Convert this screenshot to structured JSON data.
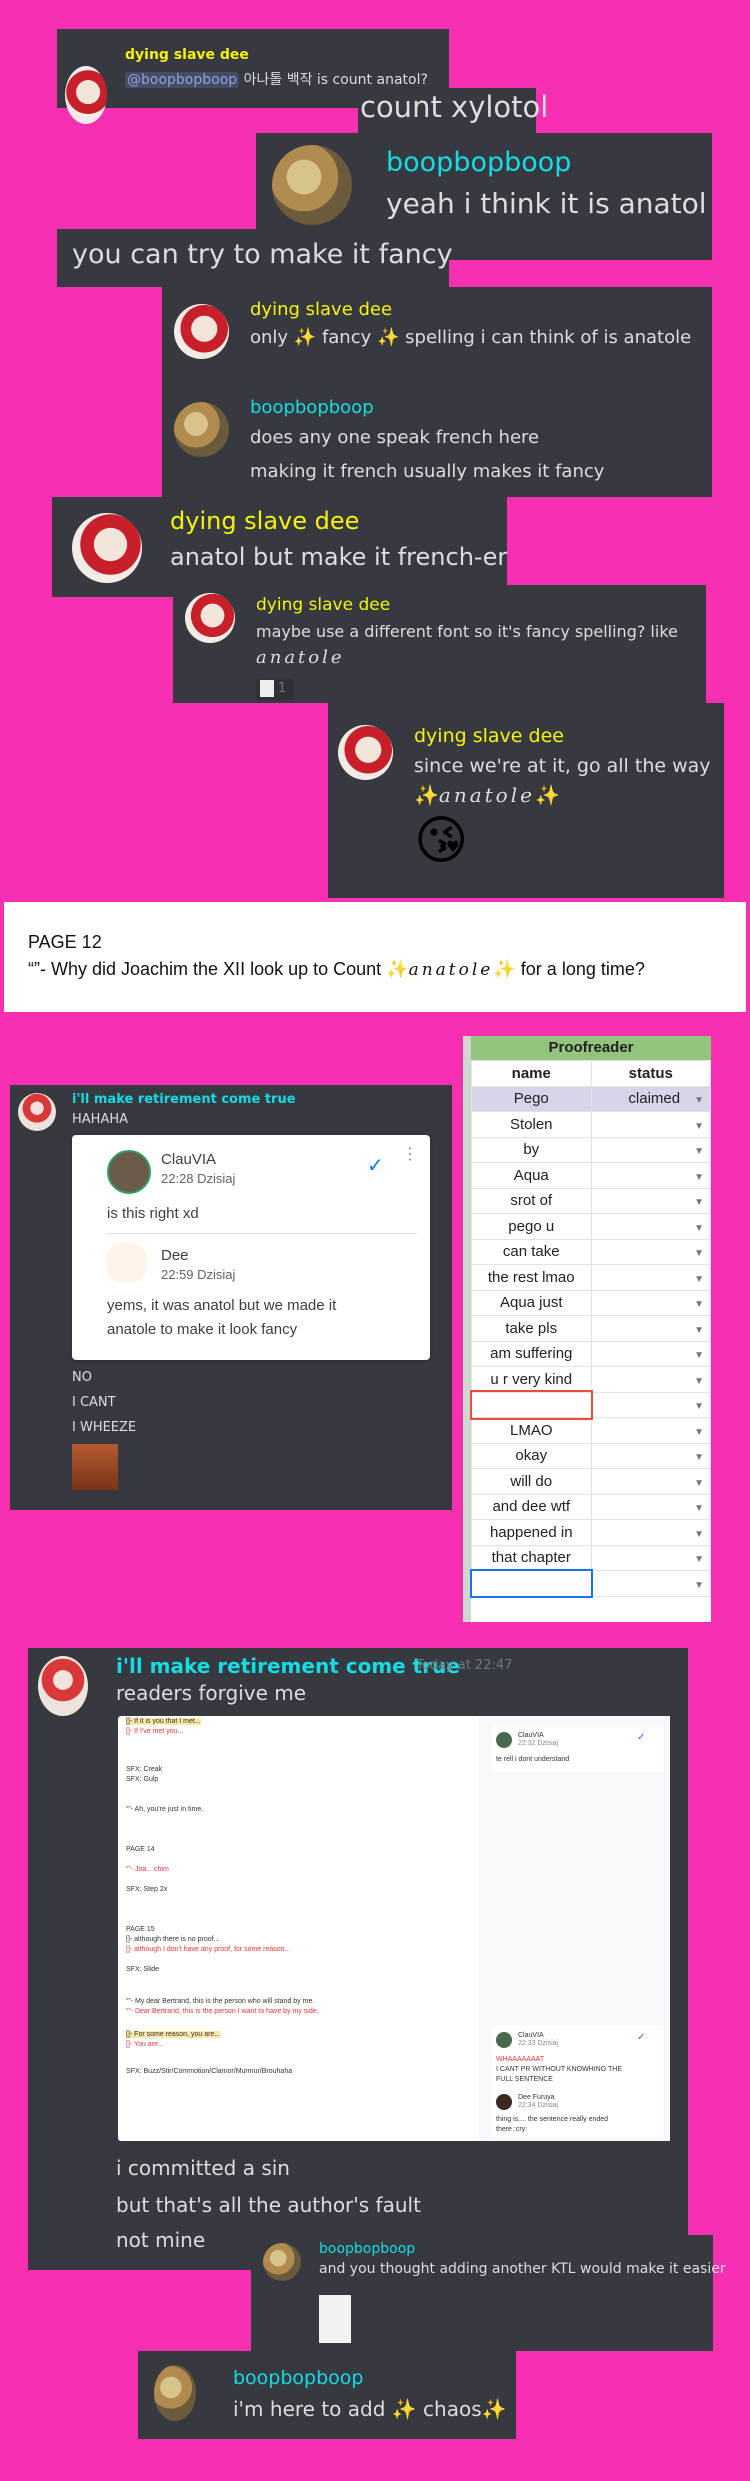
{
  "colors": {
    "background": "#f72fb1",
    "discord_bg": "#36393f",
    "name_yellow": "#f7f30a",
    "name_cyan": "#15dbe4",
    "sheet_header_green": "#93c47d",
    "sheet_claimed_row": "#d9d2e9"
  },
  "chat1": {
    "m1": {
      "author": "dying slave dee",
      "mention": "@boopbopboop",
      "text": "아나톨 백작 is count anatol?"
    },
    "m2": {
      "text": "count xylotol"
    },
    "m3": {
      "author": "boopbopboop",
      "text": "yeah i think it is anatol"
    },
    "m4": {
      "text": "you can try to make it fancy"
    },
    "m5": {
      "author": "dying slave dee",
      "text_a": "only ",
      "spark": "✨",
      "text_b": " fancy ",
      "text_c": "  spelling i can think of is anatole"
    },
    "m6": {
      "author": "boopbopboop",
      "line1": "does any one speak french here",
      "line2": "making it french usually makes it fancy"
    },
    "m7": {
      "author": "dying slave dee",
      "text": "anatol but make it french-er"
    },
    "m8": {
      "author": "dying slave dee",
      "text": "maybe use a different font so it's fancy spelling? like",
      "fancy": "anatole",
      "reaction_count": "1"
    },
    "m9": {
      "author": "dying slave dee",
      "text": "since we're at it, go all the way",
      "spark": "✨",
      "fancy": "anatole",
      "emoji": "😘"
    }
  },
  "doc_excerpt": {
    "page": "PAGE 12",
    "line_a": "“”- Why did Joachim the XII look up to Count ",
    "spark": "✨",
    "fancy": "anatole",
    "line_b": " for a long time?"
  },
  "chat2": {
    "author": "i'll make retirement come true",
    "line0": "HAHAHA",
    "comment1": {
      "author": "ClauVIA",
      "time": "22:28 Dzisiaj",
      "text": "is this right xd"
    },
    "comment2": {
      "author": "Dee",
      "time": "22:59 Dzisiaj",
      "line1": "yems, it was anatol but we made it",
      "line2": "anatole to make it look fancy"
    },
    "lines": [
      "NO",
      "I CANT",
      "I WHEEZE"
    ]
  },
  "sheet": {
    "title": "Proofreader",
    "headers": [
      "name",
      "status"
    ],
    "rows": [
      {
        "name": "Pego",
        "status": "claimed"
      },
      {
        "name": "Stolen",
        "status": ""
      },
      {
        "name": "by",
        "status": ""
      },
      {
        "name": "Aqua",
        "status": ""
      },
      {
        "name": "srot of",
        "status": ""
      },
      {
        "name": "pego u",
        "status": ""
      },
      {
        "name": "can take",
        "status": ""
      },
      {
        "name": "the rest lmao",
        "status": ""
      },
      {
        "name": "Aqua just",
        "status": ""
      },
      {
        "name": "take pls",
        "status": ""
      },
      {
        "name": "am suffering",
        "status": ""
      },
      {
        "name": "u r very kind",
        "status": ""
      },
      {
        "name": "",
        "status": ""
      },
      {
        "name": "LMAO",
        "status": ""
      },
      {
        "name": "okay",
        "status": ""
      },
      {
        "name": "will do",
        "status": ""
      },
      {
        "name": "and dee wtf",
        "status": ""
      },
      {
        "name": "happened in",
        "status": ""
      },
      {
        "name": "that chapter",
        "status": ""
      },
      {
        "name": "",
        "status": ""
      }
    ]
  },
  "chat3": {
    "author": "i'll make retirement come true",
    "timestamp": "Today at 22:47",
    "line0": "readers forgive me",
    "doc_lines": [
      {
        "t": "[]- If it is you that I met...",
        "c": "hl"
      },
      {
        "t": "[]- If I've met you...",
        "c": "red"
      },
      {
        "t": "SFX: Creak",
        "c": ""
      },
      {
        "t": "SFX: Gulp",
        "c": ""
      },
      {
        "t": "“”- Ah, you're just in time.",
        "c": ""
      },
      {
        "t": "PAGE 14",
        "c": ""
      },
      {
        "t": "“”- Joa... chim",
        "c": "red"
      },
      {
        "t": "SFX: Step 2x",
        "c": ""
      },
      {
        "t": "PAGE 15",
        "c": ""
      },
      {
        "t": "[]- although there is no proof...",
        "c": ""
      },
      {
        "t": "[]- although I don't have any proof, for some reason...",
        "c": "red"
      },
      {
        "t": "SFX: Slide",
        "c": ""
      },
      {
        "t": "“”- My dear Bertrand, this is the person who will stand by me.",
        "c": ""
      },
      {
        "t": "“”- Dear Bertrand, this is the person I want to have by my side.",
        "c": "red"
      },
      {
        "t": "[]- For some reason, you are...",
        "c": "hl"
      },
      {
        "t": "[]- You are...",
        "c": "red"
      },
      {
        "t": "SFX: Buzz/Stir/Commotion/Clamor/Murmur/Brouhaha",
        "c": ""
      }
    ],
    "side_comments": [
      {
        "author": "ClauVIA",
        "time": "22:32 Dzisiaj",
        "text": "te rell i dont understand"
      },
      {
        "author": "ClauVIA",
        "time": "22:33 Dzisiaj",
        "text": "WHAAAAAAAT",
        "text2": "I CANT PR WITHOUT KNOWHING THE",
        "text3": "FULL SENTENCE"
      },
      {
        "author": "Dee Furuya",
        "time": "22:34 Dzisiaj",
        "text": "thing is.... the sentence really ended",
        "text2": "there :cry:"
      }
    ],
    "lines": [
      "i committed a sin",
      "but that's all the author's fault",
      "not mine"
    ]
  },
  "chat4": {
    "author": "boopbopboop",
    "text": "and you thought adding another KTL would make it easier"
  },
  "chat5": {
    "author": "boopbopboop",
    "text_a": "i'm here to add ",
    "spark": "✨",
    "text_b": " chaos"
  }
}
